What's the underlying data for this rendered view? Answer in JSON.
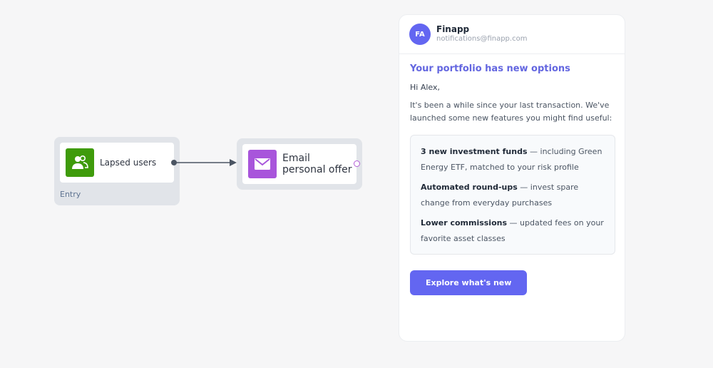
{
  "flow": {
    "entry_node": {
      "label": "Lapsed users",
      "caption": "Entry",
      "icon": "users-icon",
      "icon_color": "#3f9b0b"
    },
    "email_node": {
      "label": "Email personal offer",
      "icon": "mail-icon",
      "icon_color": "#a855db"
    }
  },
  "email_preview": {
    "avatar_initials": "FA",
    "sender_name": "Finapp",
    "sender_email": "notifications@finapp.com",
    "heading": "Your portfolio has new options",
    "greeting": "Hi Alex,",
    "intro": "It's been a while since your last transaction. We've launched some new features you might find useful:",
    "features": [
      {
        "title": "3 new investment funds",
        "text": " — including Green Energy ETF, matched to your risk profile"
      },
      {
        "title": "Automated round-ups",
        "text": " — invest spare change from everyday purchases"
      },
      {
        "title": "Lower commissions",
        "text": " — updated fees on your favorite asset classes"
      }
    ],
    "cta_label": "Explore what's new",
    "accent_color": "#6366f1"
  }
}
